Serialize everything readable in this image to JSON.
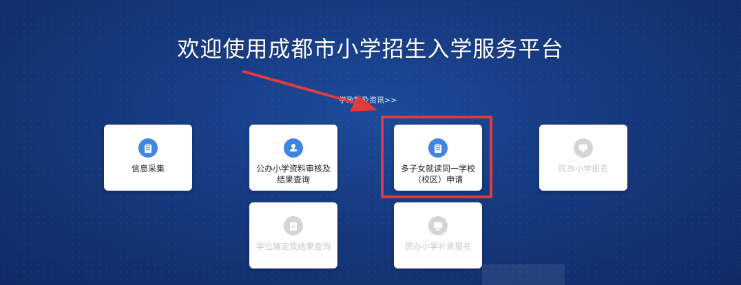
{
  "title": "欢迎使用成都市小学招生入学服务平台",
  "policy_link": "学政策及资讯>>",
  "cards": {
    "info_collect": "信息采集",
    "public_review": "公办小学资料审核及结果查询",
    "multi_child": "多子女就读同一学校（校区）申请",
    "private_signup": "民办小学报名",
    "degree_confirm": "学位确定及结果查询",
    "private_supplement": "民办小学补录报名"
  },
  "colors": {
    "highlight": "#e23b3b",
    "active_icon": "#3f86e3",
    "inactive_icon": "#d5d5d5"
  }
}
